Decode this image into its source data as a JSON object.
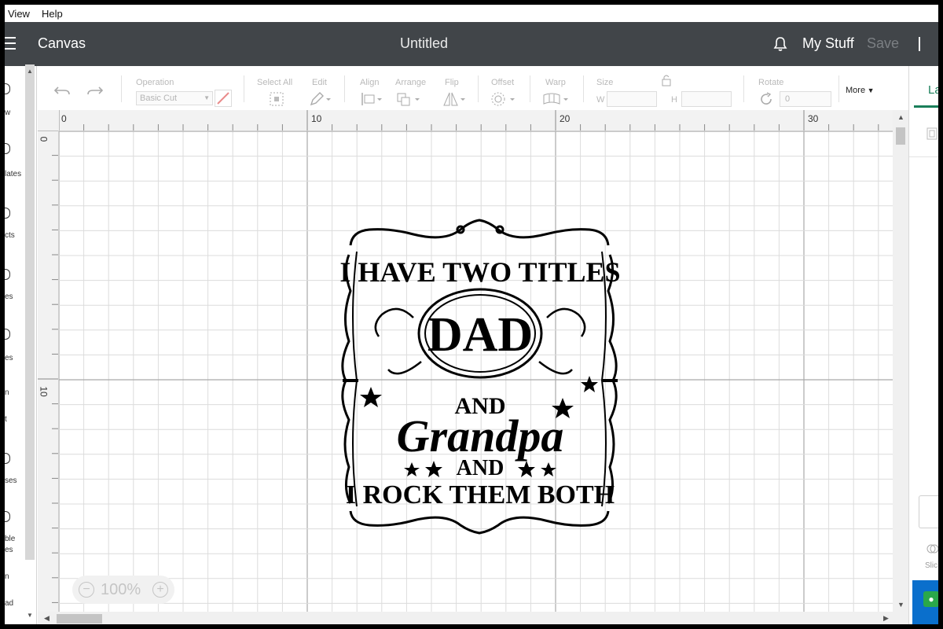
{
  "menubar": {
    "view": "View",
    "help": "Help"
  },
  "header": {
    "canvas_label": "Canvas",
    "title": "Untitled",
    "my_stuff": "My Stuff",
    "save": "Save"
  },
  "left_rail": {
    "items": [
      "w",
      "lates",
      "cts",
      "es",
      "es",
      "n",
      "t",
      "ses",
      "ble",
      "es",
      "n",
      "ad"
    ]
  },
  "toolbar": {
    "operation_label": "Operation",
    "operation_value": "Basic Cut",
    "select_all": "Select All",
    "edit": "Edit",
    "align": "Align",
    "arrange": "Arrange",
    "flip": "Flip",
    "offset": "Offset",
    "warp": "Warp",
    "size": "Size",
    "w": "W",
    "h": "H",
    "rotate": "Rotate",
    "rotate_value": "0",
    "more": "More"
  },
  "ruler": {
    "top": [
      "0",
      "10",
      "20",
      "30"
    ],
    "left": [
      "0",
      "10"
    ]
  },
  "zoom": {
    "level": "100%"
  },
  "design": {
    "line1": "I HAVE TWO TITLES",
    "line2": "DAD",
    "line3": "AND",
    "line4": "Grandpa",
    "line5": "AND",
    "line6": "I ROCK THEM BOTH"
  },
  "right_panel": {
    "tab": "La",
    "slice": "Slic"
  },
  "colors": {
    "header_bg": "#414549",
    "accent_green": "#1a7f5a",
    "blue": "#0a6fcc"
  }
}
